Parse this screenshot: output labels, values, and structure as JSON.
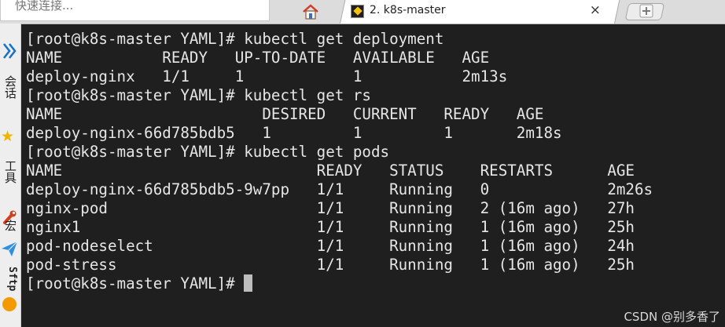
{
  "quick_connect": {
    "placeholder": "快速连接..."
  },
  "tabs": [
    {
      "label": "2. k8s-master",
      "close": "×"
    }
  ],
  "new_tab": {
    "symbol": "+"
  },
  "sidebar": {
    "items": [
      {
        "label": "会话"
      },
      {
        "label": "工具"
      },
      {
        "label": "宏"
      },
      {
        "label": "Sftp"
      }
    ]
  },
  "terminal": {
    "lines": [
      "[root@k8s-master YAML]# kubectl get deployment",
      "NAME           READY   UP-TO-DATE   AVAILABLE   AGE",
      "deploy-nginx   1/1     1            1           2m13s",
      "[root@k8s-master YAML]# kubectl get rs",
      "NAME                      DESIRED   CURRENT   READY   AGE",
      "deploy-nginx-66d785bdb5   1         1         1       2m18s",
      "[root@k8s-master YAML]# kubectl get pods",
      "NAME                            READY   STATUS    RESTARTS      AGE",
      "deploy-nginx-66d785bdb5-9w7pp   1/1     Running   0             2m26s",
      "nginx-pod                       1/1     Running   2 (16m ago)   27h",
      "nginx1                          1/1     Running   1 (16m ago)   25h",
      "pod-nodeselect                  1/1     Running   1 (16m ago)   24h",
      "pod-stress                      1/1     Running   1 (16m ago)   25h"
    ],
    "prompt": "[root@k8s-master YAML]# "
  },
  "watermark": "CSDN @别多香了",
  "icons": [
    "home-icon",
    "terminal-tab-icon",
    "close-icon",
    "new-tab-icon",
    "chevron-right-icon",
    "star-icon",
    "tool-icon",
    "paper-plane-icon",
    "sftp-icon"
  ]
}
